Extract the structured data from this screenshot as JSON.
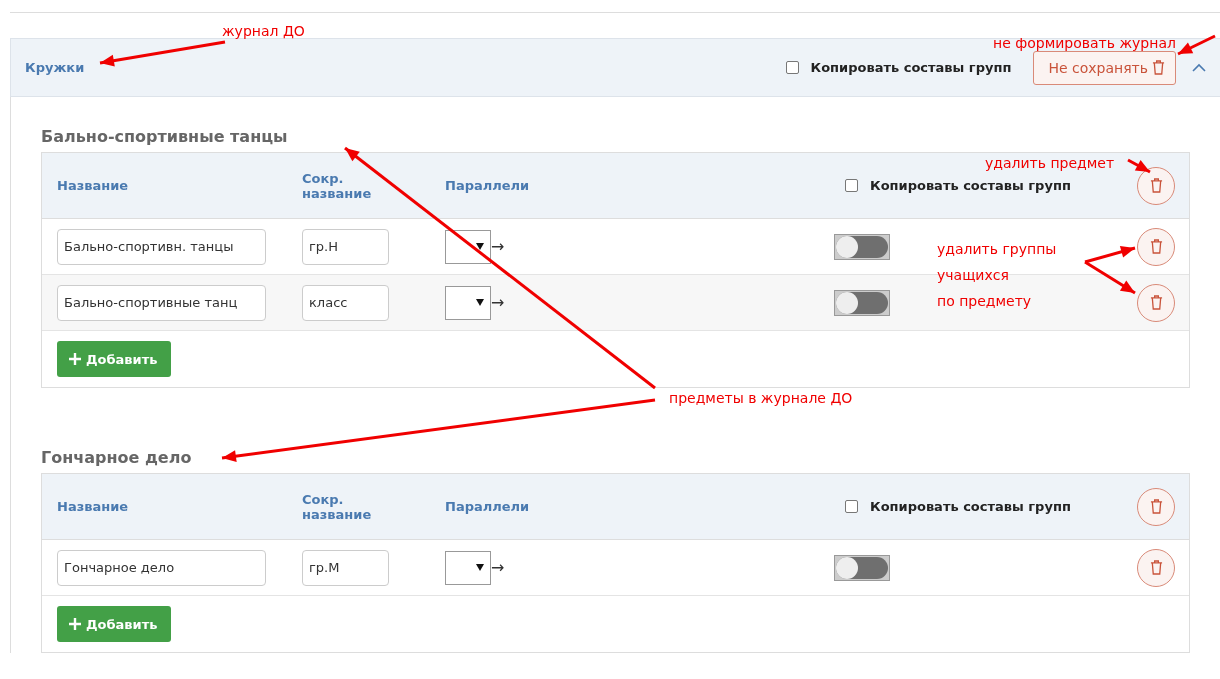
{
  "header": {
    "title": "Кружки",
    "copy_groups": {
      "label": "Копировать составы групп",
      "checked": false
    },
    "save_button": "Не сохранять",
    "expanded": true
  },
  "subjects": [
    {
      "title": "Бально-спортивные танцы",
      "columns": [
        "Название",
        "Сокр. название",
        "Параллели"
      ],
      "copy_groups": {
        "label": "Копировать составы групп",
        "checked": false
      },
      "rows": [
        {
          "name": "Бально-спортивн. танцы",
          "short": "гр.Н",
          "arrow": "→",
          "on": false
        },
        {
          "name": "Бально-спортивные танц",
          "short": "класс",
          "arrow": "→",
          "on": false
        }
      ],
      "add_button": "Добавить"
    },
    {
      "title": "Гончарное дело",
      "columns": [
        "Название",
        "Сокр. название",
        "Параллели"
      ],
      "copy_groups": {
        "label": "Копировать составы групп",
        "checked": false
      },
      "rows": [
        {
          "name": "Гончарное дело",
          "short": "гр.М",
          "arrow": "→",
          "on": false
        }
      ],
      "add_button": "Добавить"
    }
  ],
  "annotations": [
    {
      "lines": [
        "журнал ДО"
      ]
    },
    {
      "lines": [
        "не формировать журнал"
      ]
    },
    {
      "lines": [
        "удалить предмет"
      ]
    },
    {
      "lines": [
        "удалить группы",
        "учащихся",
        "по предмету"
      ]
    },
    {
      "lines": [
        "предметы в журнале ДО"
      ]
    }
  ]
}
